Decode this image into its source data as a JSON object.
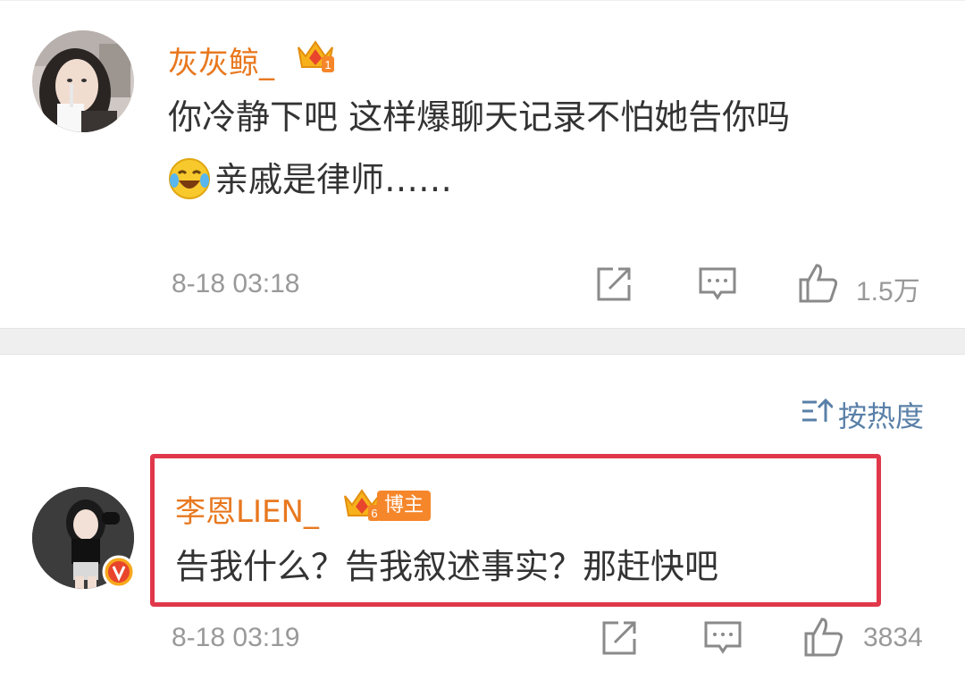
{
  "comments": [
    {
      "username": "灰灰鲸_",
      "vip_level": "1",
      "content_line1": "你冷静下吧 这样爆聊天记录不怕她告你吗",
      "emoji": "laugh-cry-emoji",
      "content_line2": "亲戚是律师……",
      "time": "8-18 03:18",
      "likes": "1.5万"
    },
    {
      "username": "李恩LIEN_",
      "vip_level": "6",
      "host_tag": "博主",
      "content": "告我什么？告我叙述事实？那赶快吧",
      "time": "8-18 03:19",
      "likes": "3834"
    }
  ],
  "sort": {
    "label": "按热度",
    "icon": "sort-icon"
  },
  "colors": {
    "username": "#e8781f",
    "highlight_border": "#e0384a",
    "sort_text": "#5a80a8",
    "meta_text": "#999999"
  },
  "icons": {
    "share": "share-icon",
    "comment": "comment-icon",
    "like": "thumbs-up-icon"
  }
}
